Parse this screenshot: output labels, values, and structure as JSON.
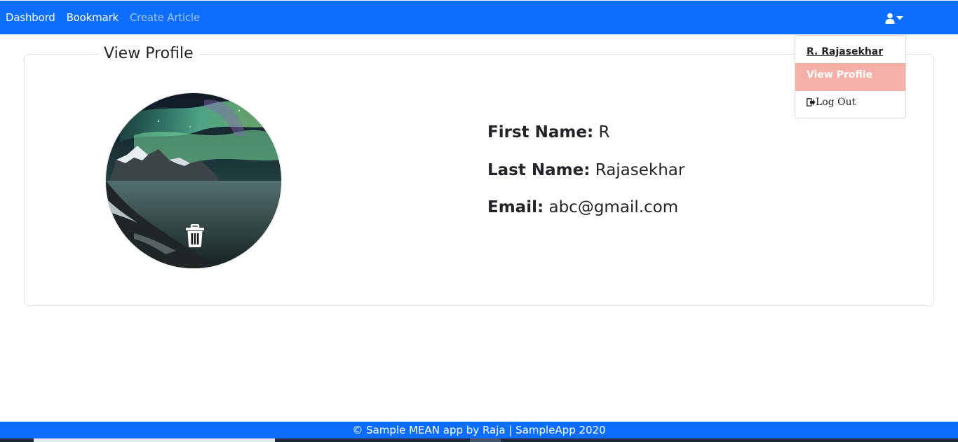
{
  "navbar": {
    "links": [
      "Dashbord",
      "Bookmark",
      "Create Article"
    ],
    "user_icon": "user-icon",
    "caret_icon": "caret-down-icon"
  },
  "dropdown": {
    "user_name": "R. Rajasekhar",
    "view_profile": "View Profile",
    "logout": "Log Out",
    "logout_icon": "sign-out-icon"
  },
  "profile": {
    "legend": "View Profile",
    "avatar_icon": "aurora-landscape-photo",
    "delete_icon": "trash-icon",
    "fields": [
      {
        "label": "First Name:",
        "value": "R"
      },
      {
        "label": "Last Name:",
        "value": "Rajasekhar"
      },
      {
        "label": "Email:",
        "value": "abc@gmail.com"
      }
    ]
  },
  "footer": {
    "text": "© Sample MEAN app by Raja | SampleApp 2020"
  },
  "colors": {
    "primary": "#0d6efd",
    "dropdown_active": "#f4b0a6"
  }
}
